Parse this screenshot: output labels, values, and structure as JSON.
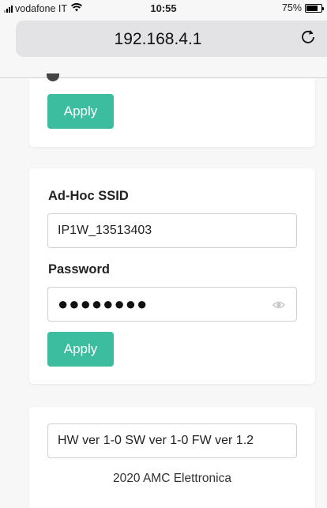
{
  "status_bar": {
    "carrier": "vodafone IT",
    "wifi_icon": "wifi-icon",
    "time": "10:55",
    "battery_text": "75%",
    "battery_level": 0.75
  },
  "address_bar": {
    "url": "192.168.4.1",
    "reload_icon": "reload-icon"
  },
  "card1": {
    "apply_label": "Apply"
  },
  "adhoc": {
    "ssid_label": "Ad-Hoc SSID",
    "ssid_value": "IP1W_13513403",
    "password_label": "Password",
    "password_masked": "●●●●●●●●",
    "eye_icon": "eye-icon",
    "apply_label": "Apply"
  },
  "info": {
    "version_text": "HW ver 1-0 SW ver 1-0 FW ver 1.2",
    "footer": "2020 AMC Elettronica"
  },
  "colors": {
    "accent": "#3dbda0",
    "background": "#f7f7f7"
  }
}
